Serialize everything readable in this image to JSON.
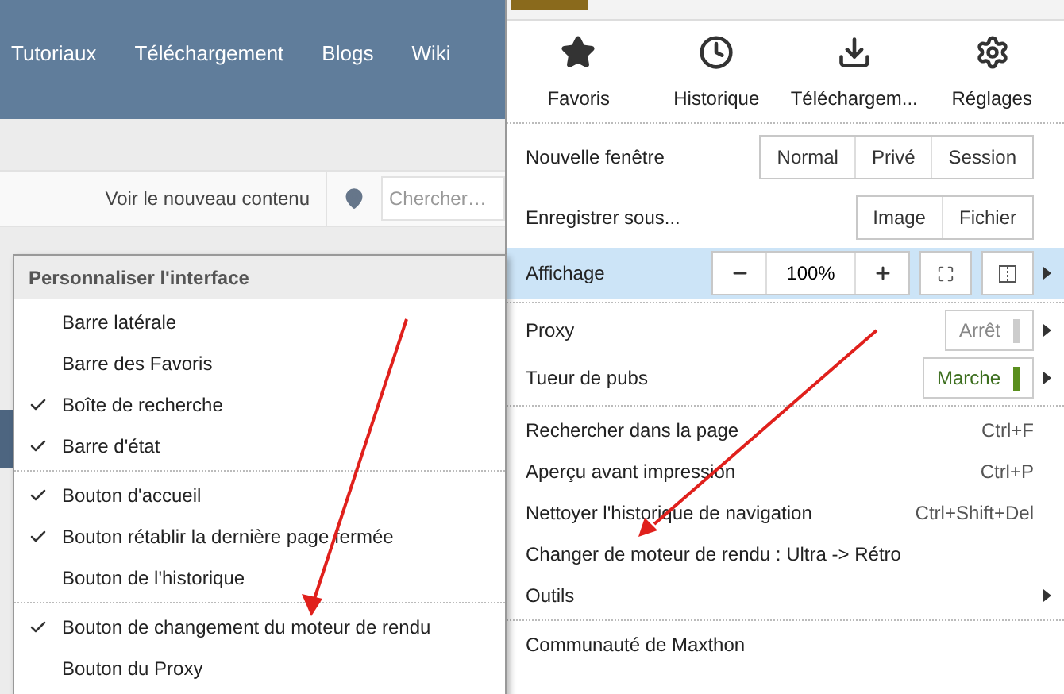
{
  "site": {
    "nav": [
      "Tutoriaux",
      "Téléchargement",
      "Blogs",
      "Wiki"
    ],
    "new_content_link": "Voir le nouveau contenu",
    "search": {
      "placeholder": "Chercher…"
    }
  },
  "menu": {
    "quick_actions": [
      {
        "kind": "star",
        "label": "Favoris"
      },
      {
        "kind": "clock",
        "label": "Historique"
      },
      {
        "kind": "download",
        "label": "Téléchargem..."
      },
      {
        "kind": "gear",
        "label": "Réglages"
      }
    ],
    "sections": [
      [
        {
          "kind": "buttons",
          "label": "Nouvelle fenêtre",
          "selected": false,
          "submenu": false,
          "buttons": [
            "Normal",
            "Privé",
            "Session"
          ]
        },
        {
          "kind": "buttons",
          "label": "Enregistrer sous...",
          "selected": false,
          "submenu": false,
          "buttons": [
            "Image",
            "Fichier"
          ]
        },
        {
          "kind": "zoom",
          "label": "Affichage",
          "selected": true,
          "submenu": true,
          "zoom": "100%"
        }
      ],
      [
        {
          "kind": "toggle",
          "label": "Proxy",
          "selected": false,
          "submenu": true,
          "state": "Arrêt",
          "on": false
        },
        {
          "kind": "toggle",
          "label": "Tueur de pubs",
          "selected": false,
          "submenu": true,
          "state": "Marche",
          "on": true
        }
      ],
      [
        {
          "kind": "shortcut",
          "label": "Rechercher dans la page",
          "selected": false,
          "submenu": false,
          "shortcut": "Ctrl+F"
        },
        {
          "kind": "shortcut",
          "label": "Aperçu avant impression",
          "selected": false,
          "submenu": false,
          "shortcut": "Ctrl+P"
        },
        {
          "kind": "shortcut",
          "label": "Nettoyer l'historique de navigation",
          "selected": false,
          "submenu": false,
          "shortcut": "Ctrl+Shift+Del"
        },
        {
          "kind": "plain",
          "label": "Changer de moteur de rendu : Ultra -> Rétro",
          "selected": false,
          "submenu": false
        },
        {
          "kind": "plain",
          "label": "Outils",
          "selected": false,
          "submenu": true
        }
      ],
      [
        {
          "kind": "plain",
          "label": "Communauté de Maxthon",
          "selected": false,
          "submenu": false
        }
      ]
    ]
  },
  "submenu": {
    "title": "Personnaliser l'interface",
    "sections": [
      [
        {
          "label": "Barre latérale",
          "checked": false
        },
        {
          "label": "Barre des Favoris",
          "checked": false
        },
        {
          "label": "Boîte de recherche",
          "checked": true
        },
        {
          "label": "Barre d'état",
          "checked": true
        }
      ],
      [
        {
          "label": "Bouton d'accueil",
          "checked": true
        },
        {
          "label": "Bouton rétablir la dernière page fermée",
          "checked": true
        },
        {
          "label": "Bouton de l'historique",
          "checked": false
        }
      ],
      [
        {
          "label": "Bouton de changement du moteur de rendu",
          "checked": true
        },
        {
          "label": "Bouton du Proxy",
          "checked": false
        }
      ]
    ]
  }
}
